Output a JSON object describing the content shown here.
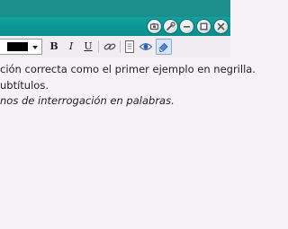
{
  "colors": {
    "title_bar": "#0a8e8b",
    "text_color_swatch": "#000000",
    "content_background": "#f6f2f6"
  },
  "window_controls": [
    {
      "name": "screenshot-icon"
    },
    {
      "name": "wrench-icon"
    },
    {
      "name": "minimize-icon"
    },
    {
      "name": "maximize-icon"
    },
    {
      "name": "close-icon"
    }
  ],
  "toolbar": {
    "text_color": "#000000",
    "bold_label": "B",
    "italic_label": "I",
    "underline_label": "U",
    "link_icon": "link-icon",
    "source_icon": "document-icon",
    "preview_icon": "eye-icon",
    "clear_icon": "eraser-icon"
  },
  "editor": {
    "line1": "ción correcta como el primer ejemplo en negrilla.",
    "line2": "ubtítulos.",
    "line3": "nos de interrogación en palabras."
  }
}
